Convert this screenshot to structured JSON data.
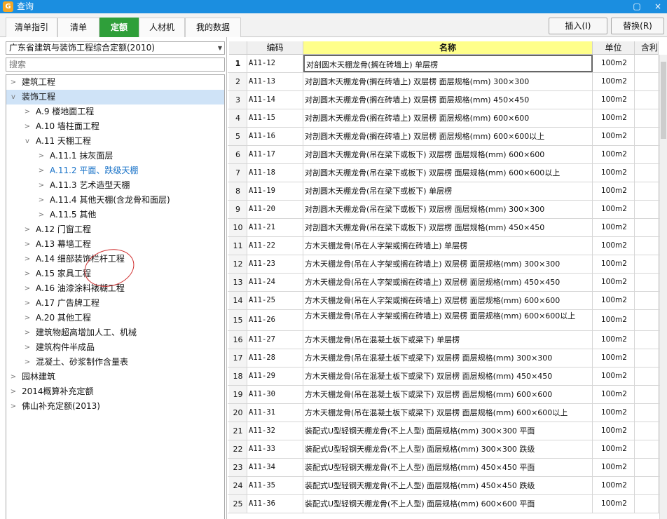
{
  "window": {
    "title": "查询",
    "app_icon": "G",
    "close": "×",
    "minimize": "▢"
  },
  "tabs": [
    "清单指引",
    "清单",
    "定额",
    "人材机",
    "我的数据"
  ],
  "toolbar": {
    "insert": "插入(I)",
    "replace": "替换(R)"
  },
  "left_panel": {
    "select_value": "广东省建筑与装饰工程综合定额(2010)",
    "search_placeholder": "搜索",
    "tree": [
      {
        "label": "建筑工程",
        "level": 0,
        "toggle": ">"
      },
      {
        "label": "装饰工程",
        "level": 0,
        "toggle": "v"
      },
      {
        "label": "A.9 楼地面工程",
        "level": 1,
        "toggle": ">"
      },
      {
        "label": "A.10 墙柱面工程",
        "level": 1,
        "toggle": ">"
      },
      {
        "label": "A.11 天棚工程",
        "level": 1,
        "toggle": "v"
      },
      {
        "label": "A.11.1 抹灰面层",
        "level": 2,
        "toggle": ">"
      },
      {
        "label": "A.11.2 平面、跌级天棚",
        "level": 2,
        "toggle": ">"
      },
      {
        "label": "A.11.3 艺术造型天棚",
        "level": 2,
        "toggle": ">"
      },
      {
        "label": "A.11.4 其他天棚(含龙骨和面层)",
        "level": 2,
        "toggle": ">"
      },
      {
        "label": "A.11.5 其他",
        "level": 2,
        "toggle": ">"
      },
      {
        "label": "A.12 门窗工程",
        "level": 1,
        "toggle": ">"
      },
      {
        "label": "A.13 幕墙工程",
        "level": 1,
        "toggle": ">"
      },
      {
        "label": "A.14 细部装饰栏杆工程",
        "level": 1,
        "toggle": ">"
      },
      {
        "label": "A.15 家具工程",
        "level": 1,
        "toggle": ">"
      },
      {
        "label": "A.16 油漆涂料裱糊工程",
        "level": 1,
        "toggle": ">"
      },
      {
        "label": "A.17 广告牌工程",
        "level": 1,
        "toggle": ">"
      },
      {
        "label": "A.20 其他工程",
        "level": 1,
        "toggle": ">"
      },
      {
        "label": "建筑物超高增加人工、机械",
        "level": 1,
        "toggle": ">"
      },
      {
        "label": "建筑构件半成品",
        "level": 1,
        "toggle": ">"
      },
      {
        "label": "混凝土、砂浆制作含量表",
        "level": 1,
        "toggle": ">"
      },
      {
        "label": "园林建筑",
        "level": 0,
        "toggle": ">"
      },
      {
        "label": "2014概算补充定额",
        "level": 0,
        "toggle": ">"
      },
      {
        "label": "佛山补充定额(2013)",
        "level": 0,
        "toggle": ">"
      }
    ]
  },
  "table": {
    "headers": {
      "code": "编码",
      "name": "名称",
      "unit": "单位",
      "extra": "含利"
    },
    "rows": [
      {
        "idx": "1",
        "code": "A11-12",
        "name": "对剖圆木天棚龙骨(搁在砖墙上) 单层楞",
        "unit": "100m2"
      },
      {
        "idx": "2",
        "code": "A11-13",
        "name": "对剖圆木天棚龙骨(搁在砖墙上) 双层楞 面层规格(mm) 300×300",
        "unit": "100m2"
      },
      {
        "idx": "3",
        "code": "A11-14",
        "name": "对剖圆木天棚龙骨(搁在砖墙上) 双层楞 面层规格(mm) 450×450",
        "unit": "100m2"
      },
      {
        "idx": "4",
        "code": "A11-15",
        "name": "对剖圆木天棚龙骨(搁在砖墙上) 双层楞 面层规格(mm) 600×600",
        "unit": "100m2"
      },
      {
        "idx": "5",
        "code": "A11-16",
        "name": "对剖圆木天棚龙骨(搁在砖墙上) 双层楞 面层规格(mm) 600×600以上",
        "unit": "100m2"
      },
      {
        "idx": "6",
        "code": "A11-17",
        "name": "对剖圆木天棚龙骨(吊在梁下或板下) 双层楞 面层规格(mm) 600×600",
        "unit": "100m2"
      },
      {
        "idx": "7",
        "code": "A11-18",
        "name": "对剖圆木天棚龙骨(吊在梁下或板下) 双层楞 面层规格(mm) 600×600以上",
        "unit": "100m2"
      },
      {
        "idx": "8",
        "code": "A11-19",
        "name": "对剖圆木天棚龙骨(吊在梁下或板下) 单层楞",
        "unit": "100m2"
      },
      {
        "idx": "9",
        "code": "A11-20",
        "name": "对剖圆木天棚龙骨(吊在梁下或板下) 双层楞 面层规格(mm) 300×300",
        "unit": "100m2"
      },
      {
        "idx": "10",
        "code": "A11-21",
        "name": "对剖圆木天棚龙骨(吊在梁下或板下) 双层楞 面层规格(mm) 450×450",
        "unit": "100m2"
      },
      {
        "idx": "11",
        "code": "A11-22",
        "name": "方木天棚龙骨(吊在人字架或搁在砖墙上) 单层楞",
        "unit": "100m2"
      },
      {
        "idx": "12",
        "code": "A11-23",
        "name": "方木天棚龙骨(吊在人字架或搁在砖墙上) 双层楞 面层规格(mm) 300×300",
        "unit": "100m2"
      },
      {
        "idx": "13",
        "code": "A11-24",
        "name": "方木天棚龙骨(吊在人字架或搁在砖墙上) 双层楞 面层规格(mm) 450×450",
        "unit": "100m2"
      },
      {
        "idx": "14",
        "code": "A11-25",
        "name": "方木天棚龙骨(吊在人字架或搁在砖墙上) 双层楞 面层规格(mm) 600×600",
        "unit": "100m2"
      },
      {
        "idx": "15",
        "code": "A11-26",
        "name": "方木天棚龙骨(吊在人字架或搁在砖墙上) 双层楞 面层规格(mm) 600×600以上",
        "unit": "100m2"
      },
      {
        "idx": "16",
        "code": "A11-27",
        "name": "方木天棚龙骨(吊在混凝土板下或梁下) 单层楞",
        "unit": "100m2"
      },
      {
        "idx": "17",
        "code": "A11-28",
        "name": "方木天棚龙骨(吊在混凝土板下或梁下) 双层楞 面层规格(mm) 300×300",
        "unit": "100m2"
      },
      {
        "idx": "18",
        "code": "A11-29",
        "name": "方木天棚龙骨(吊在混凝土板下或梁下) 双层楞 面层规格(mm) 450×450",
        "unit": "100m2"
      },
      {
        "idx": "19",
        "code": "A11-30",
        "name": "方木天棚龙骨(吊在混凝土板下或梁下) 双层楞 面层规格(mm) 600×600",
        "unit": "100m2"
      },
      {
        "idx": "20",
        "code": "A11-31",
        "name": "方木天棚龙骨(吊在混凝土板下或梁下) 双层楞 面层规格(mm) 600×600以上",
        "unit": "100m2"
      },
      {
        "idx": "21",
        "code": "A11-32",
        "name": "装配式U型轻钢天棚龙骨(不上人型) 面层规格(mm) 300×300 平面",
        "unit": "100m2"
      },
      {
        "idx": "22",
        "code": "A11-33",
        "name": "装配式U型轻钢天棚龙骨(不上人型) 面层规格(mm) 300×300 跌级",
        "unit": "100m2"
      },
      {
        "idx": "23",
        "code": "A11-34",
        "name": "装配式U型轻钢天棚龙骨(不上人型) 面层规格(mm) 450×450 平面",
        "unit": "100m2"
      },
      {
        "idx": "24",
        "code": "A11-35",
        "name": "装配式U型轻钢天棚龙骨(不上人型) 面层规格(mm) 450×450 跌级",
        "unit": "100m2"
      },
      {
        "idx": "25",
        "code": "A11-36",
        "name": "装配式U型轻钢天棚龙骨(不上人型) 面层规格(mm) 600×600 平面",
        "unit": "100m2"
      }
    ]
  },
  "colors": {
    "titlebar": "#1b8ee0",
    "active_tab": "#2f9f3a",
    "name_header": "#ffff8a",
    "selected_node": "#cfe3f7",
    "link_blue": "#1a73c8"
  }
}
